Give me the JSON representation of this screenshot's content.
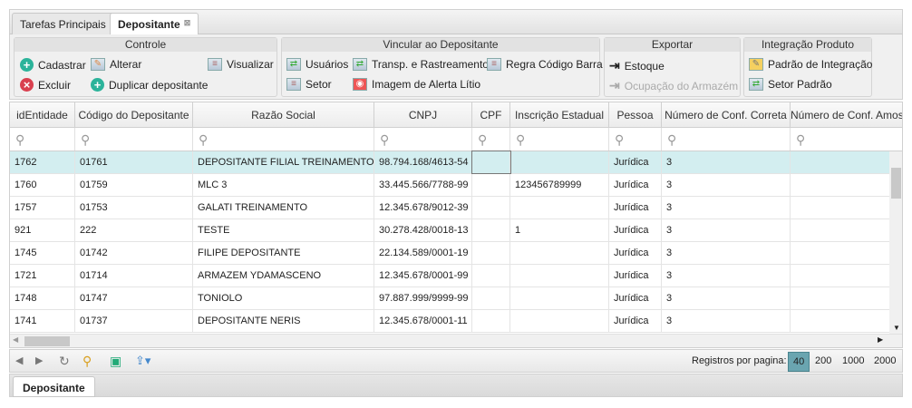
{
  "tabs": [
    {
      "label": "Tarefas Principais"
    },
    {
      "label": "Depositante"
    }
  ],
  "toolbar": {
    "controle": {
      "title": "Controle",
      "cadastrar": "Cadastrar",
      "alterar": "Alterar",
      "visualizar": "Visualizar",
      "excluir": "Excluir",
      "duplicar": "Duplicar depositante"
    },
    "vincular": {
      "title": "Vincular ao Depositante",
      "usuarios": "Usuários",
      "transp": "Transp. e Rastreamento",
      "regra": "Regra Código Barra",
      "setor": "Setor",
      "imagem": "Imagem de Alerta Lítio"
    },
    "exportar": {
      "title": "Exportar",
      "estoque": "Estoque",
      "ocupacao": "Ocupação do Armazém"
    },
    "integracao": {
      "title": "Integração Produto",
      "padrao": "Padrão de Integração",
      "setor_padrao": "Setor Padrão"
    }
  },
  "grid": {
    "columns": [
      "idEntidade",
      "Código do Depositante",
      "Razão Social",
      "CNPJ",
      "CPF",
      "Inscrição Estadual",
      "Pessoa",
      "Número de Conf. Correta",
      "Número de Conf. Amos"
    ],
    "rows": [
      [
        "1762",
        "01761",
        "DEPOSITANTE FILIAL TREINAMENTO",
        "98.794.168/4613-54",
        "",
        "",
        "Jurídica",
        "3",
        ""
      ],
      [
        "1760",
        "01759",
        "MLC 3",
        "33.445.566/7788-99",
        "",
        "123456789999",
        "Jurídica",
        "3",
        ""
      ],
      [
        "1757",
        "01753",
        "GALATI TREINAMENTO",
        "12.345.678/9012-39",
        "",
        "",
        "Jurídica",
        "3",
        ""
      ],
      [
        "921",
        "222",
        "TESTE",
        "30.278.428/0018-13",
        "",
        "1",
        "Jurídica",
        "3",
        ""
      ],
      [
        "1745",
        "01742",
        "FILIPE DEPOSITANTE",
        "22.134.589/0001-19",
        "",
        "",
        "Jurídica",
        "3",
        ""
      ],
      [
        "1721",
        "01714",
        "ARMAZEM YDAMASCENO",
        "12.345.678/0001-99",
        "",
        "",
        "Jurídica",
        "3",
        ""
      ],
      [
        "1748",
        "01747",
        "TONIOLO",
        "97.887.999/9999-99",
        "",
        "",
        "Jurídica",
        "3",
        ""
      ],
      [
        "1741",
        "01737",
        "DEPOSITANTE NERIS",
        "12.345.678/0001-11",
        "",
        "",
        "Jurídica",
        "3",
        ""
      ]
    ]
  },
  "pager": {
    "label": "Registros por pagina:",
    "options": [
      "40",
      "200",
      "1000",
      "2000"
    ],
    "selected": "40"
  },
  "bottom_tab": "Depositante"
}
